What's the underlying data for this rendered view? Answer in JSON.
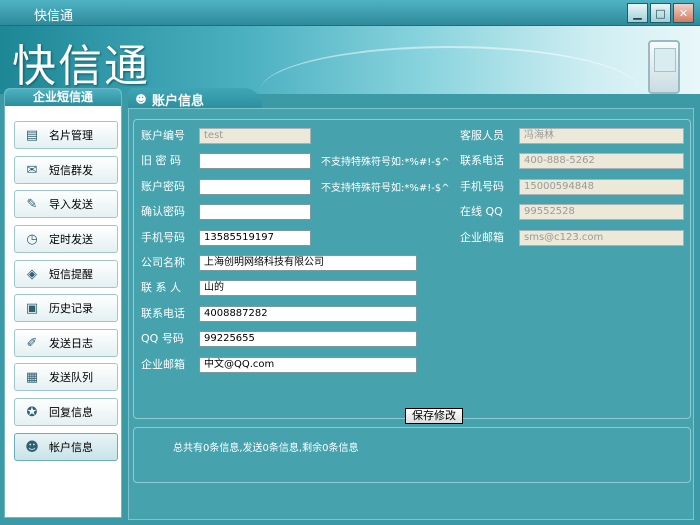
{
  "window": {
    "title": "快信通"
  },
  "banner": {
    "logo": "快信通"
  },
  "sidebar": {
    "heading": "企业短信通",
    "items": [
      {
        "label": "名片管理",
        "icon": "contact-card-icon"
      },
      {
        "label": "短信群发",
        "icon": "broadcast-icon"
      },
      {
        "label": "导入发送",
        "icon": "import-icon"
      },
      {
        "label": "定时发送",
        "icon": "clock-icon"
      },
      {
        "label": "短信提醒",
        "icon": "reminder-icon"
      },
      {
        "label": "历史记录",
        "icon": "history-icon"
      },
      {
        "label": "发送日志",
        "icon": "log-icon"
      },
      {
        "label": "发送队列",
        "icon": "queue-icon"
      },
      {
        "label": "回复信息",
        "icon": "reply-icon"
      },
      {
        "label": "帐户信息",
        "icon": "user-icon"
      }
    ]
  },
  "tab": {
    "label": "账户信息"
  },
  "form": {
    "account_no_label": "账户编号",
    "account_no": "test",
    "old_pwd_label": "旧 密 码",
    "old_pwd": "",
    "pwd_label": "账户密码",
    "pwd": "",
    "confirm_label": "确认密码",
    "confirm": "",
    "mobile_label": "手机号码",
    "mobile": "13585519197",
    "company_label": "公司名称",
    "company": "上海创明网络科技有限公司",
    "contact_label": "联 系 人",
    "contact": "山的",
    "phone_label": "联系电话",
    "phone": "4008887282",
    "qq_label": "QQ 号码",
    "qq": "99225655",
    "email_label": "企业邮箱",
    "email": "中文@QQ.com",
    "hint1": "不支持特殊符号如:*%#!-$^",
    "hint2": "不支持特殊符号如:*%#!-$^",
    "save_label": "保存修改"
  },
  "service": {
    "staff_label": "客服人员",
    "staff": "冯海林",
    "phone_label": "联系电话",
    "phone": "400-888-5262",
    "mobile_label": "手机号码",
    "mobile": "15000594848",
    "qq_label": "在线  QQ",
    "qq": "99552528",
    "email_label": "企业邮箱",
    "email": "sms@c123.com"
  },
  "summary": "总共有0条信息,发送0条信息,剩余0条信息"
}
